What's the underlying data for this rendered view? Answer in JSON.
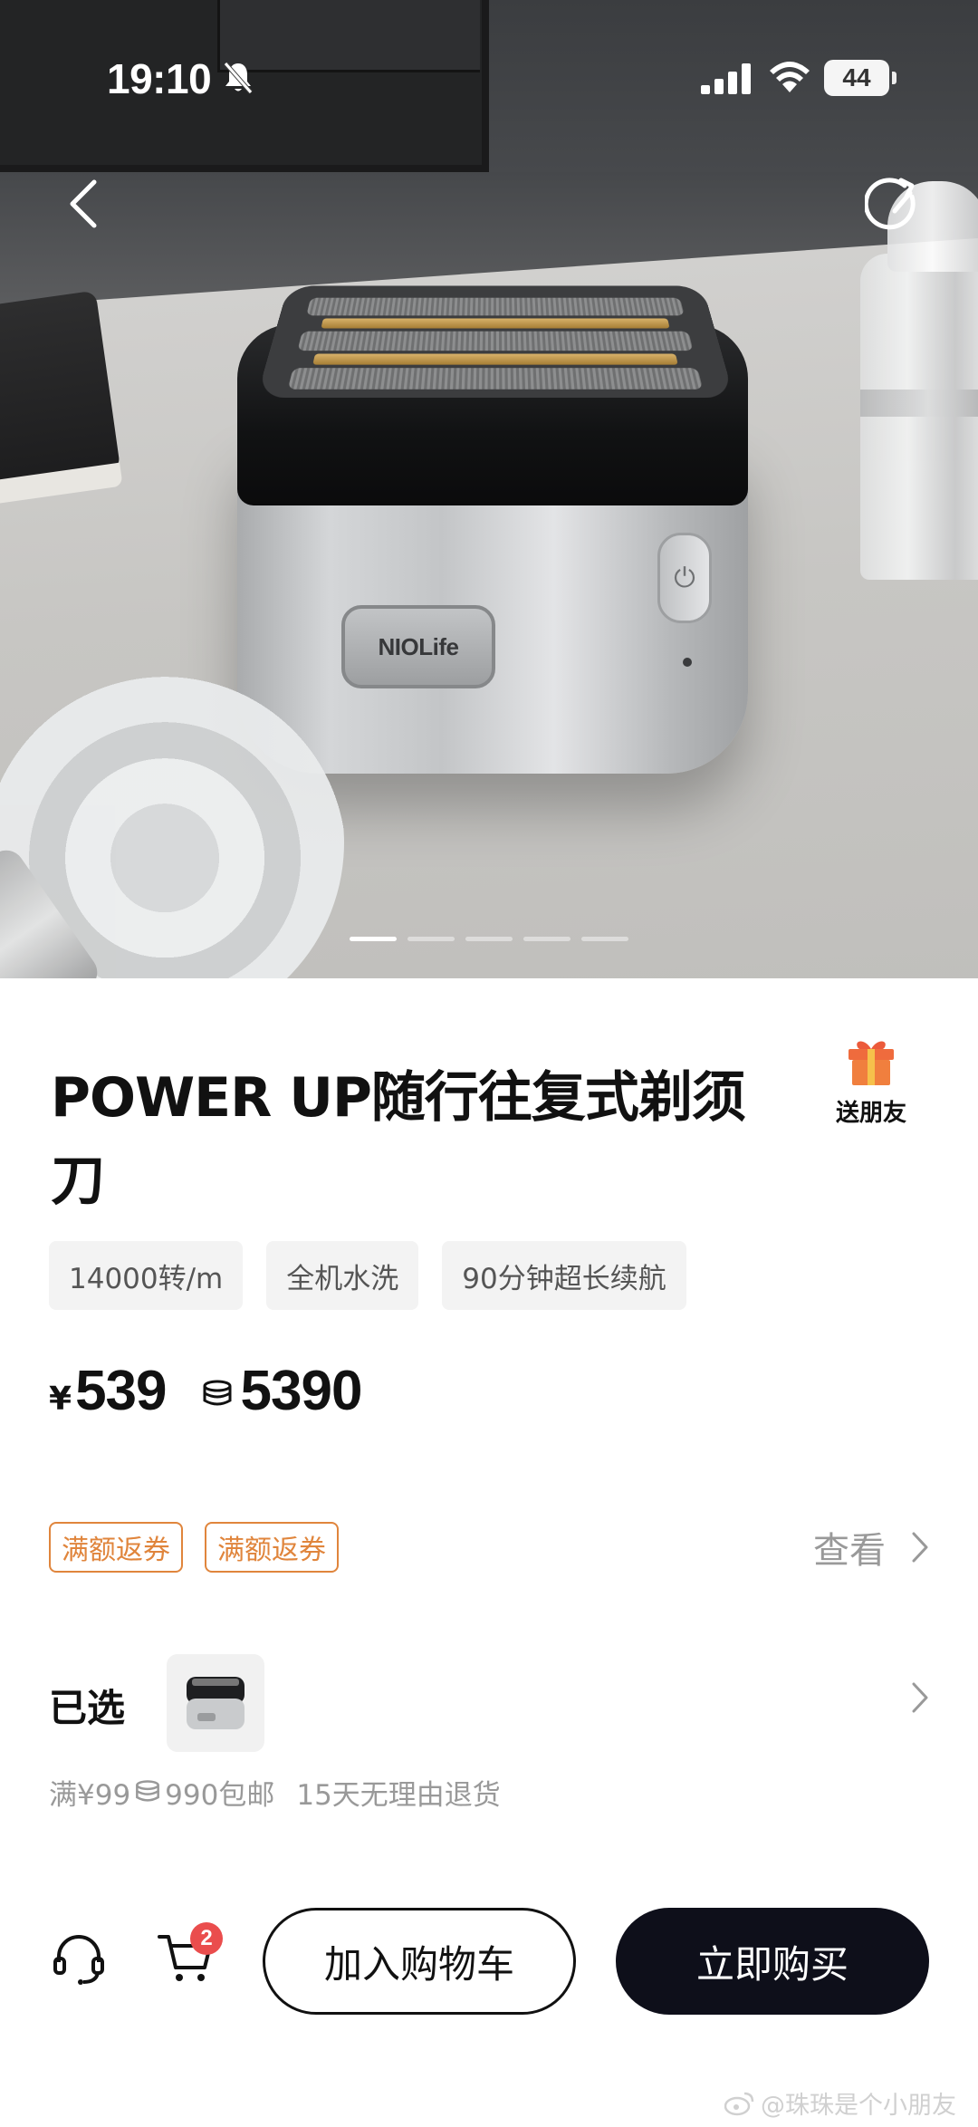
{
  "status_bar": {
    "time": "19:10",
    "battery": "44"
  },
  "hero": {
    "brand_logo_text": "NIOLife",
    "carousel": {
      "total": 5,
      "active_index": 0
    }
  },
  "product": {
    "title": "POWER UP随行往复式剃须刀",
    "gift_label": "送朋友",
    "tags": [
      "14000转/m",
      "全机水洗",
      "90分钟超长续航"
    ],
    "currency_symbol": "¥",
    "price": "539",
    "points": "5390",
    "coupons": [
      "满额返券",
      "满额返券"
    ],
    "coupon_view_label": "查看",
    "selected_label": "已选",
    "shipping": {
      "free_ship_prefix": "满¥99",
      "free_ship_points": "990包邮",
      "returns": "15天无理由退货"
    }
  },
  "bottom_bar": {
    "cart_count": "2",
    "add_to_cart_label": "加入购物车",
    "buy_now_label": "立即购买"
  },
  "watermark": "@珠珠是个小朋友",
  "colors": {
    "accent_orange": "#e0853c",
    "buy_button": "#0e0f1a",
    "badge_red": "#ea4d4d",
    "muted_text": "#999999"
  }
}
